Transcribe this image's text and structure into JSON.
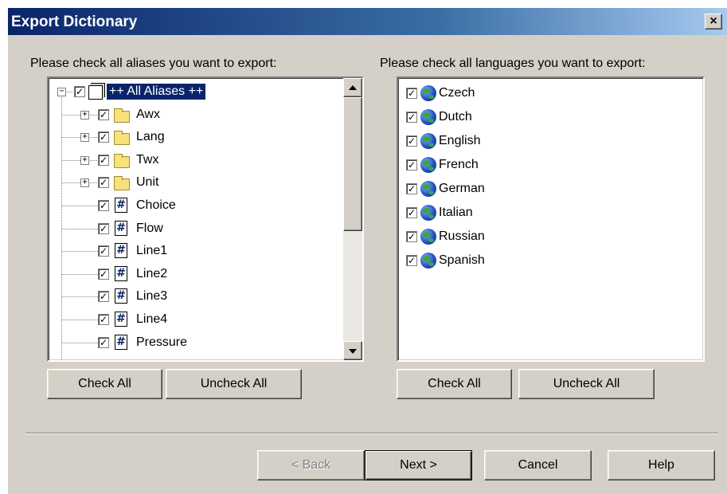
{
  "window": {
    "title": "Export Dictionary",
    "close_label": "×"
  },
  "aliases": {
    "label": "Please check all aliases you want to export:",
    "root": {
      "label": "++ All Aliases ++",
      "checked": true,
      "expander": "−"
    },
    "folders": [
      {
        "label": "Awx",
        "checked": true,
        "expander": "+"
      },
      {
        "label": "Lang",
        "checked": true,
        "expander": "+"
      },
      {
        "label": "Twx",
        "checked": true,
        "expander": "+"
      },
      {
        "label": "Unit",
        "checked": true,
        "expander": "+"
      }
    ],
    "items": [
      {
        "label": "Choice",
        "checked": true
      },
      {
        "label": "Flow",
        "checked": true
      },
      {
        "label": "Line1",
        "checked": true
      },
      {
        "label": "Line2",
        "checked": true
      },
      {
        "label": "Line3",
        "checked": true
      },
      {
        "label": "Line4",
        "checked": true
      },
      {
        "label": "Pressure",
        "checked": true
      }
    ],
    "item_icon": "#",
    "check_all": "Check All",
    "uncheck_all": "Uncheck All"
  },
  "languages": {
    "label": "Please check all languages you want to export:",
    "items": [
      {
        "label": "Czech",
        "checked": true
      },
      {
        "label": "Dutch",
        "checked": true
      },
      {
        "label": "English",
        "checked": true
      },
      {
        "label": "French",
        "checked": true
      },
      {
        "label": "German",
        "checked": true
      },
      {
        "label": "Italian",
        "checked": true
      },
      {
        "label": "Russian",
        "checked": true
      },
      {
        "label": "Spanish",
        "checked": true
      }
    ],
    "check_all": "Check All",
    "uncheck_all": "Uncheck All"
  },
  "footer": {
    "back": "< Back",
    "next": "Next >",
    "cancel": "Cancel",
    "help": "Help"
  },
  "check_mark": "✓"
}
